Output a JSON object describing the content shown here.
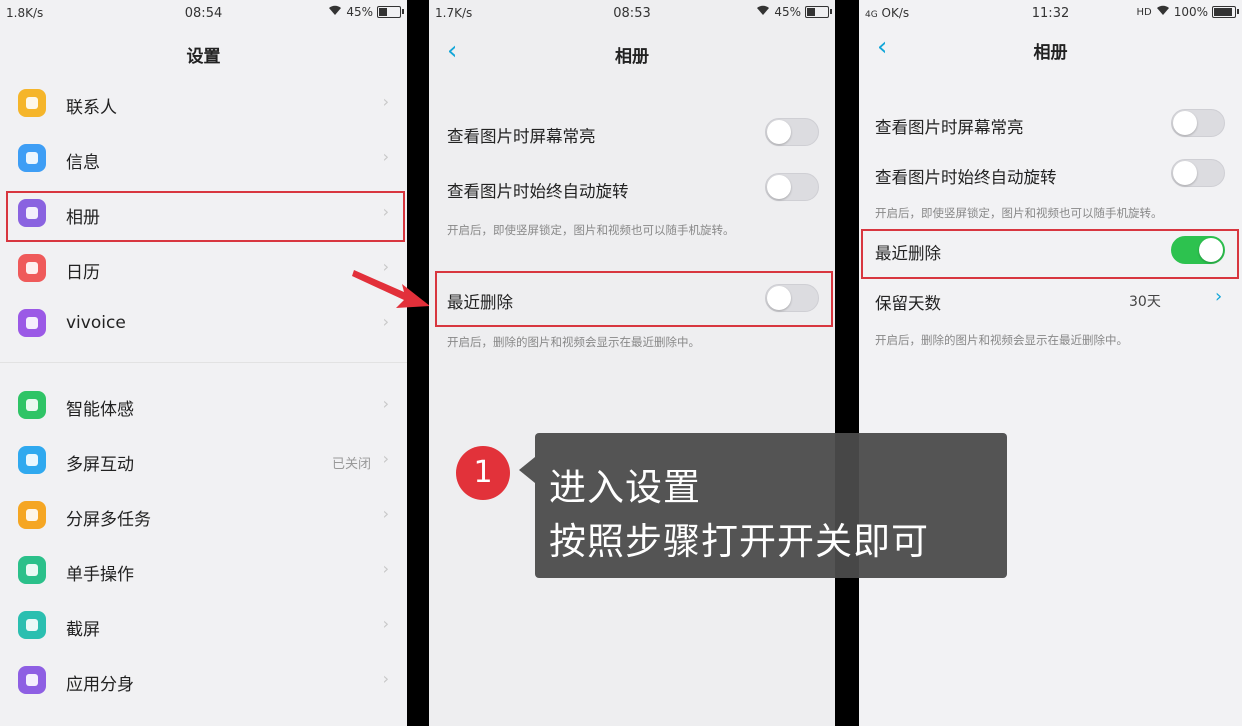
{
  "panel1": {
    "status": {
      "net": "1.8K/s",
      "time": "08:54",
      "battery": "45%",
      "battery_level": 0.45
    },
    "title": "设置",
    "items": [
      {
        "label": "联系人",
        "icon": "contacts-icon",
        "color": "#f5b52a",
        "value": ""
      },
      {
        "label": "信息",
        "icon": "message-icon",
        "color": "#3e9ef5",
        "value": ""
      },
      {
        "label": "相册",
        "icon": "album-icon",
        "color": "#8a63e0",
        "value": ""
      },
      {
        "label": "日历",
        "icon": "calendar-icon",
        "color": "#ef5a5a",
        "value": ""
      },
      {
        "label": "vivoice",
        "icon": "voice-icon",
        "color": "#9b59e6",
        "value": ""
      },
      {
        "label": "智能体感",
        "icon": "motion-icon",
        "color": "#2fc466",
        "value": ""
      },
      {
        "label": "多屏互动",
        "icon": "multiscreen-icon",
        "color": "#30a9ef",
        "value": "已关闭"
      },
      {
        "label": "分屏多任务",
        "icon": "splitscreen-icon",
        "color": "#f5a623",
        "value": ""
      },
      {
        "label": "单手操作",
        "icon": "onehand-icon",
        "color": "#2bc08a",
        "value": ""
      },
      {
        "label": "截屏",
        "icon": "screenshot-icon",
        "color": "#2bbfb0",
        "value": ""
      },
      {
        "label": "应用分身",
        "icon": "app-clone-icon",
        "color": "#8e5fe3",
        "value": ""
      }
    ]
  },
  "panel2": {
    "status": {
      "net": "1.7K/s",
      "time": "08:53",
      "battery": "45%",
      "battery_level": 0.45
    },
    "title": "相册",
    "opt1": "查看图片时屏幕常亮",
    "opt2": "查看图片时始终自动旋转",
    "hint1": "开启后，即使竖屏锁定，图片和视频也可以随手机旋转。",
    "opt3": "最近删除",
    "hint2": "开启后，删除的图片和视频会显示在最近删除中。"
  },
  "panel3": {
    "status": {
      "net": "OK/s",
      "time": "11:32",
      "battery": "100%",
      "battery_level": 1.0,
      "signal_label": "4G",
      "hd_label": "HD"
    },
    "title": "相册",
    "opt1": "查看图片时屏幕常亮",
    "opt2": "查看图片时始终自动旋转",
    "hint1": "开启后，即使竖屏锁定，图片和视频也可以随手机旋转。",
    "opt3": "最近删除",
    "retain_label": "保留天数",
    "retain_value": "30天",
    "hint2": "开启后，删除的图片和视频会显示在最近删除中。"
  },
  "callout": {
    "step": "1",
    "line1": "进入设置",
    "line2": "按照步骤打开开关即可"
  },
  "colors": {
    "highlight": "#d8363f",
    "toggle_on": "#2dc24f",
    "accent": "#12a6d8"
  }
}
